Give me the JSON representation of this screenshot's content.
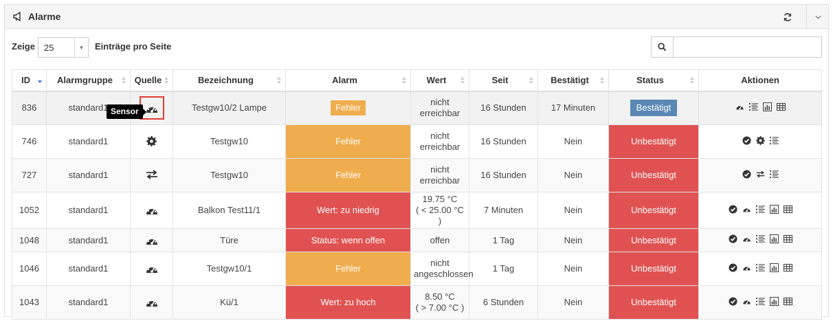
{
  "panel": {
    "title": "Alarme",
    "refresh_icon": "refresh-icon",
    "collapse_icon": "chevron-down-icon",
    "header_icon": "bullhorn-icon"
  },
  "toolbar": {
    "show_label": "Zeige",
    "page_size": "25",
    "entries_label": "Einträge pro Seite",
    "search_value": "",
    "search_placeholder": ""
  },
  "tooltip": "Sensor",
  "columns": {
    "id": "ID",
    "group": "Alarmgruppe",
    "source": "Quelle",
    "name": "Bezeichnung",
    "alarm": "Alarm",
    "value": "Wert",
    "since": "Seit",
    "ack": "Bestätigt",
    "status": "Status",
    "actions": "Aktionen"
  },
  "rows": [
    {
      "id": "836",
      "group": "standard1",
      "source": "sensor",
      "name": "Testgw10/2 Lampe",
      "alarm": "Fehler",
      "value1": "nicht",
      "value2": "erreichbar",
      "since": "16 Stunden",
      "ack": "17 Minuten",
      "status": "Bestätigt"
    },
    {
      "id": "746",
      "group": "standard1",
      "source": "gear",
      "name": "Testgw10",
      "alarm": "Fehler",
      "value1": "nicht",
      "value2": "erreichbar",
      "since": "16 Stunden",
      "ack": "Nein",
      "status": "Unbestätigt"
    },
    {
      "id": "727",
      "group": "standard1",
      "source": "exchange",
      "name": "Testgw10",
      "alarm": "Fehler",
      "value1": "nicht",
      "value2": "erreichbar",
      "since": "16 Stunden",
      "ack": "Nein",
      "status": "Unbestätigt"
    },
    {
      "id": "1052",
      "group": "standard1",
      "source": "sensor",
      "name": "Balkon Test11/1",
      "alarm": "Wert: zu niedrig",
      "value1": "19.75 °C",
      "value2": "( < 25.00 °C )",
      "since": "7 Minuten",
      "ack": "Nein",
      "status": "Unbestätigt"
    },
    {
      "id": "1048",
      "group": "standard1",
      "source": "sensor",
      "name": "Türe",
      "alarm": "Status: wenn offen",
      "value1": "offen",
      "value2": "",
      "since": "1 Tag",
      "ack": "Nein",
      "status": "Unbestätigt"
    },
    {
      "id": "1046",
      "group": "standard1",
      "source": "sensor",
      "name": "Testgw10/1",
      "alarm": "Fehler",
      "value1": "nicht",
      "value2": "angeschlossen",
      "since": "1 Tag",
      "ack": "Nein",
      "status": "Unbestätigt"
    },
    {
      "id": "1043",
      "group": "standard1",
      "source": "sensor",
      "name": "Kü/1",
      "alarm": "Wert: zu hoch",
      "value1": "8.50 °C",
      "value2": "( > 7.00 °C )",
      "since": "6 Stunden",
      "ack": "Nein",
      "status": "Unbestätigt"
    }
  ],
  "colors": {
    "warning": "#f0ad4e",
    "danger": "#e05252",
    "primary": "#5a88b5",
    "highlight_border": "#e53935"
  }
}
